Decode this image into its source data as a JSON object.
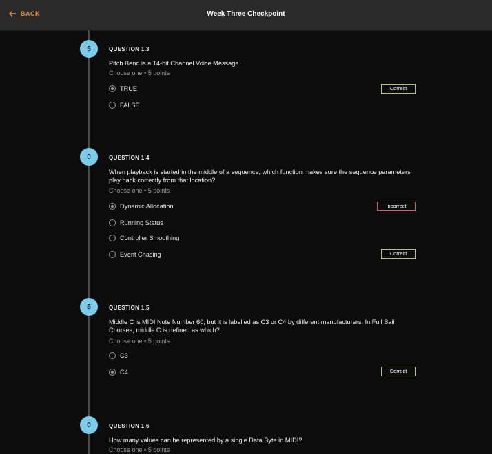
{
  "header": {
    "back_label": "BACK",
    "title": "Week Three Checkpoint"
  },
  "colors": {
    "accent_back": "#e58a3c",
    "badge": "#7ccce9",
    "correct_border": "#aac28a",
    "incorrect_border": "#d16060"
  },
  "questions": [
    {
      "score": "5",
      "number": "QUESTION 1.3",
      "text": "Pitch Bend is a 14-bit Channel Voice Message",
      "meta": "Choose one • 5 points",
      "options": [
        {
          "label": "TRUE",
          "selected": true,
          "feedback": "Correct"
        },
        {
          "label": "FALSE",
          "selected": false,
          "feedback": ""
        }
      ]
    },
    {
      "score": "0",
      "number": "QUESTION 1.4",
      "text": "When playback is started in the middle of a sequence, which function makes sure the sequence parameters play back correctly from that location?",
      "meta": "Choose one • 5 points",
      "options": [
        {
          "label": "Dynamic Allocation",
          "selected": true,
          "feedback": "Incorrect"
        },
        {
          "label": "Running Status",
          "selected": false,
          "feedback": ""
        },
        {
          "label": "Controller Smoothing",
          "selected": false,
          "feedback": ""
        },
        {
          "label": "Event Chasing",
          "selected": false,
          "feedback": "Correct"
        }
      ]
    },
    {
      "score": "5",
      "number": "QUESTION 1.5",
      "text": "Middle C is MIDI Note Number 60, but it is labelled as C3 or C4 by different manufacturers. In Full Sail Courses, middle C is defined as which?",
      "meta": "Choose one • 5 points",
      "options": [
        {
          "label": "C3",
          "selected": false,
          "feedback": ""
        },
        {
          "label": "C4",
          "selected": true,
          "feedback": "Correct"
        }
      ]
    },
    {
      "score": "0",
      "number": "QUESTION 1.6",
      "text": "How many values can be represented by a single Data Byte in MIDI?",
      "meta": "Choose one • 5 points",
      "options": []
    }
  ]
}
